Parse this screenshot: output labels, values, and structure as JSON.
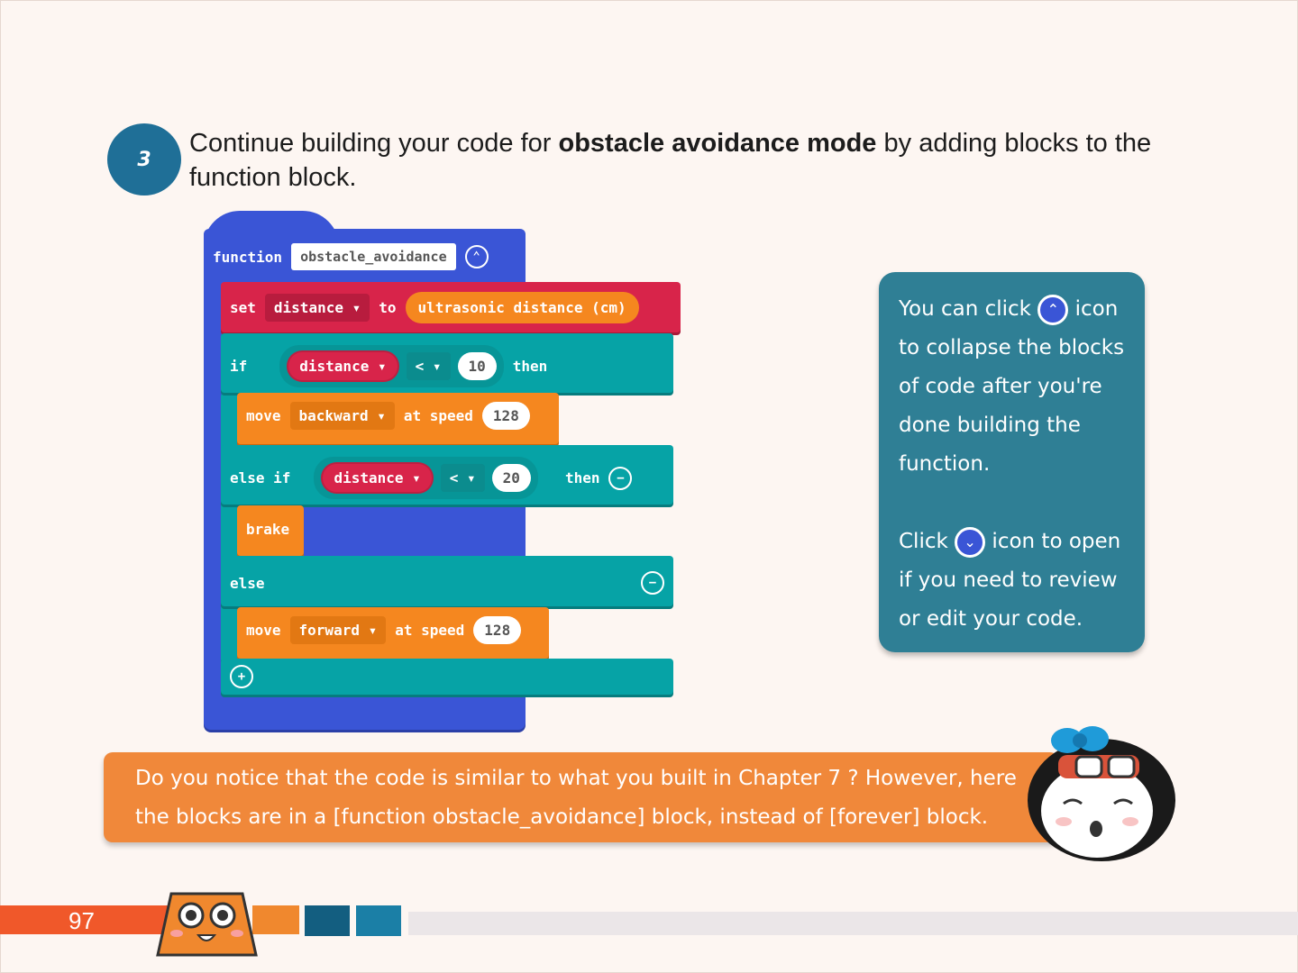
{
  "step": {
    "number": "3",
    "text_before": "Continue building your code for ",
    "text_bold": "obstacle avoidance mode",
    "text_after": " by adding blocks to the function block."
  },
  "code": {
    "function_keyword": "function",
    "function_name": "obstacle_avoidance",
    "set_keyword": "set",
    "set_variable": "distance ▾",
    "to_keyword": "to",
    "sensor": "ultrasonic distance (cm)",
    "if_keyword": "if",
    "if_variable": "distance ▾",
    "if_operator": "< ▾",
    "if_value": "10",
    "then_keyword": "then",
    "move1_keyword": "move",
    "move1_direction": "backward ▾",
    "at_speed": "at speed",
    "move1_speed": "128",
    "elseif_keyword": "else if",
    "elseif_variable": "distance ▾",
    "elseif_operator": "< ▾",
    "elseif_value": "20",
    "brake_keyword": "brake",
    "else_keyword": "else",
    "move2_keyword": "move",
    "move2_direction": "forward ▾",
    "move2_speed": "128"
  },
  "callout": {
    "line1a": "You can click ",
    "line1b": " icon to collapse the blocks of code after you're done building the function.",
    "line2a": "Click ",
    "line2b": " icon to open if you need to review or edit your code."
  },
  "note": {
    "text": "Do you notice that the code is similar to what you built in Chapter 7 ? However, here the blocks are in a  [function obstacle_avoidance] block, instead of [forever] block."
  },
  "footer": {
    "page_number": "97"
  },
  "icons": {
    "collapse": "chevron-up-circle-icon",
    "expand": "chevron-down-circle-icon",
    "remove": "minus-circle-icon",
    "add": "plus-circle-icon"
  },
  "colors": {
    "function_block": "#3a55d6",
    "variables_block": "#d8244a",
    "logic_block": "#06a3a6",
    "motor_block": "#f5871f",
    "callout_bg": "#2f7f95",
    "note_bg": "#f0883a"
  }
}
